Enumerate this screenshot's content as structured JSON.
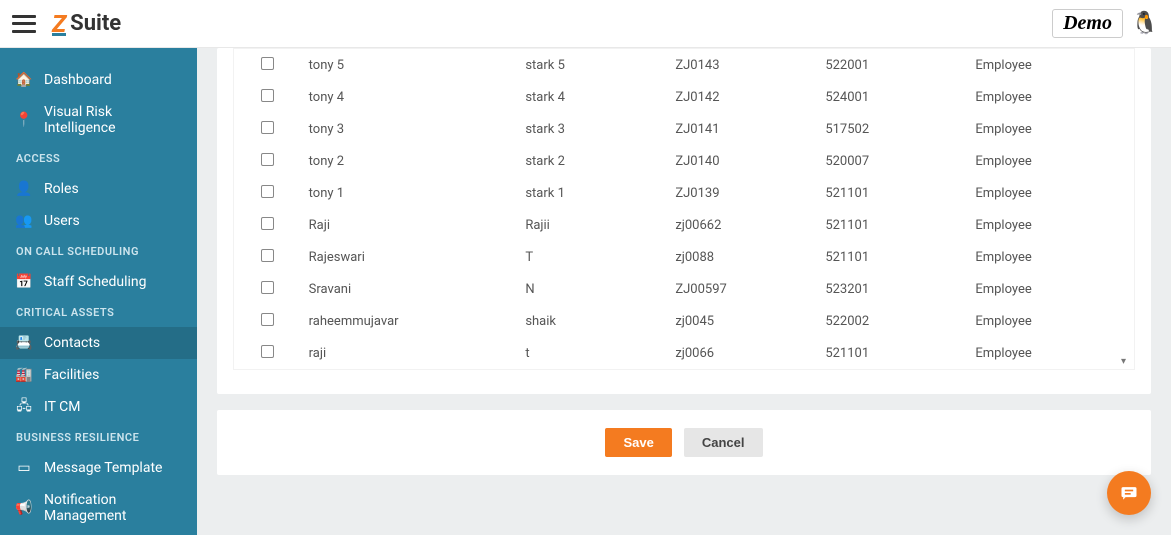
{
  "header": {
    "brand_mark": "Z",
    "brand_text": "Suite",
    "badge": "Demo",
    "avatar_glyph": "🐧"
  },
  "sidebar": {
    "top": [
      {
        "icon": "dashboard-icon",
        "glyph": "🏠",
        "label": "Dashboard"
      },
      {
        "icon": "pin-icon",
        "glyph": "📍",
        "label": "Visual Risk Intelligence"
      }
    ],
    "sections": [
      {
        "title": "ACCESS",
        "items": [
          {
            "icon": "user-icon",
            "glyph": "👤",
            "label": "Roles"
          },
          {
            "icon": "users-icon",
            "glyph": "👥",
            "label": "Users"
          }
        ]
      },
      {
        "title": "ON CALL SCHEDULING",
        "items": [
          {
            "icon": "calendar-icon",
            "glyph": "📅",
            "label": "Staff Scheduling"
          }
        ]
      },
      {
        "title": "CRITICAL ASSETS",
        "items": [
          {
            "icon": "contacts-icon",
            "glyph": "📇",
            "label": "Contacts",
            "active": true
          },
          {
            "icon": "facility-icon",
            "glyph": "🏭",
            "label": "Facilities"
          },
          {
            "icon": "itcm-icon",
            "glyph": "🖧",
            "label": "IT CM"
          }
        ]
      },
      {
        "title": "BUSINESS RESILIENCE",
        "items": [
          {
            "icon": "template-icon",
            "glyph": "▭",
            "label": "Message Template"
          },
          {
            "icon": "notify-icon",
            "glyph": "📢",
            "label": "Notification Management"
          }
        ]
      }
    ]
  },
  "table": {
    "rows": [
      {
        "first": "tony 5",
        "last": "stark 5",
        "emp": "ZJ0143",
        "pin": "522001",
        "type": "Employee"
      },
      {
        "first": "tony 4",
        "last": "stark 4",
        "emp": "ZJ0142",
        "pin": "524001",
        "type": "Employee"
      },
      {
        "first": "tony 3",
        "last": "stark 3",
        "emp": "ZJ0141",
        "pin": "517502",
        "type": "Employee"
      },
      {
        "first": "tony 2",
        "last": "stark 2",
        "emp": "ZJ0140",
        "pin": "520007",
        "type": "Employee"
      },
      {
        "first": "tony 1",
        "last": "stark 1",
        "emp": "ZJ0139",
        "pin": "521101",
        "type": "Employee"
      },
      {
        "first": "Raji",
        "last": "Rajii",
        "emp": "zj00662",
        "pin": "521101",
        "type": "Employee"
      },
      {
        "first": "Rajeswari",
        "last": "T",
        "emp": "zj0088",
        "pin": "521101",
        "type": "Employee"
      },
      {
        "first": "Sravani",
        "last": "N",
        "emp": "ZJ00597",
        "pin": "523201",
        "type": "Employee"
      },
      {
        "first": "raheemmujavar",
        "last": "shaik",
        "emp": "zj0045",
        "pin": "522002",
        "type": "Employee"
      },
      {
        "first": "raji",
        "last": "t",
        "emp": "zj0066",
        "pin": "521101",
        "type": "Employee"
      }
    ]
  },
  "actions": {
    "save": "Save",
    "cancel": "Cancel"
  }
}
